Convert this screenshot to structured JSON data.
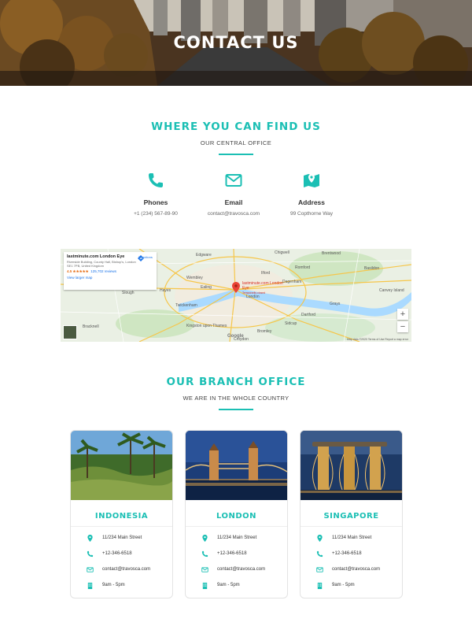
{
  "hero": {
    "title": "CONTACT US"
  },
  "find_us": {
    "title": "WHERE YOU CAN FIND US",
    "subtitle": "OUR CENTRAL OFFICE",
    "items": [
      {
        "icon": "phone-icon",
        "label": "Phones",
        "value": "+1 (234) 567-89-90"
      },
      {
        "icon": "email-icon",
        "label": "Email",
        "value": "contact@travosca.com"
      },
      {
        "icon": "map-pin-icon",
        "label": "Address",
        "value": "99 Copthorne Way"
      }
    ]
  },
  "map": {
    "place_title": "lastminute.com London Eye",
    "place_address": "Riverside Building, County Hall, Bishop's, London SE1 7PB, United Kingdom",
    "rating": "4.5",
    "stars": "★★★★★",
    "reviews": "125,702 reviews",
    "larger_map": "View larger map",
    "directions": "Directions",
    "pin_label": "lastminute.com London Eye",
    "pin_sub": "Temporarily closed",
    "labels": [
      "Edgware",
      "Chigwell",
      "Brentwood",
      "Romford",
      "Basildon",
      "Wembley",
      "Dagenham",
      "Ilford",
      "Hayes",
      "Slough",
      "Ealing",
      "London",
      "Twickenham",
      "Kingston upon Thames",
      "Dartford",
      "Grays",
      "Canvey Island",
      "Bracknell",
      "Bromley",
      "Sidcup",
      "Croydon"
    ],
    "google": "Google",
    "footer": "Map data ©2020  Terms of Use  Report a map error",
    "zoom_in": "+",
    "zoom_out": "−"
  },
  "branch": {
    "title": "OUR BRANCH OFFICE",
    "subtitle": "WE ARE IN THE WHOLE COUNTRY",
    "cards": [
      {
        "name": "INDONESIA",
        "address": "11/234 Main Street",
        "phone": "+12-346-6518",
        "email": "contact@travosca.com",
        "hours": "9am - 5pm"
      },
      {
        "name": "LONDON",
        "address": "11/234 Main Street",
        "phone": "+12-346-6518",
        "email": "contact@travosca.com",
        "hours": "9am - 5pm"
      },
      {
        "name": "SINGAPORE",
        "address": "11/234 Main Street",
        "phone": "+12-346-6518",
        "email": "contact@travosca.com",
        "hours": "9am - 5pm"
      }
    ]
  },
  "colors": {
    "accent": "#1bbfb4",
    "text": "#333333"
  }
}
